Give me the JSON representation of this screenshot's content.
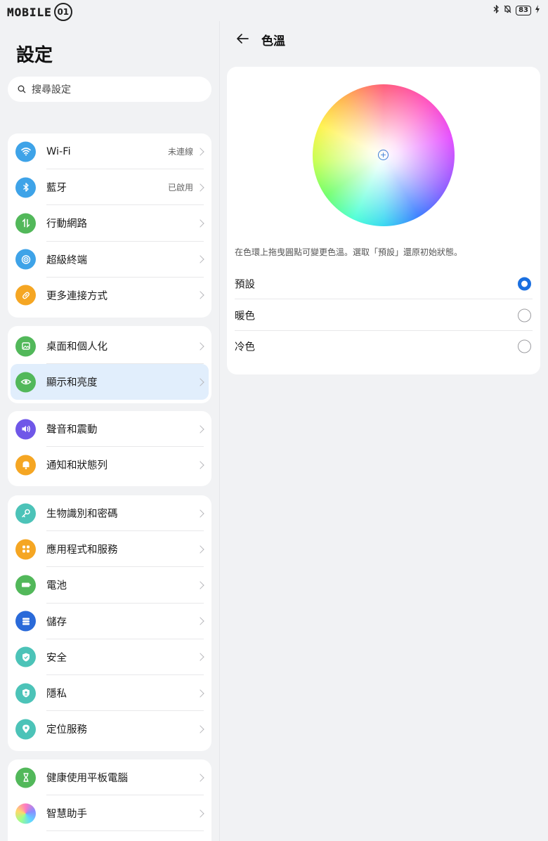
{
  "status_bar": {
    "logo": "MOBILE",
    "battery": "83"
  },
  "left_panel": {
    "title": "設定",
    "search_placeholder": "搜尋設定",
    "groups": [
      {
        "items": [
          {
            "label": "Wi-Fi",
            "value": "未連線",
            "icon": "wifi-icon",
            "color": "#3ea3e8"
          },
          {
            "label": "藍牙",
            "value": "已啟用",
            "icon": "bluetooth-icon",
            "color": "#3ea3e8"
          },
          {
            "label": "行動網路",
            "value": "",
            "icon": "mobile-data-icon",
            "color": "#52b85a"
          },
          {
            "label": "超級終端",
            "value": "",
            "icon": "super-device-icon",
            "color": "#3ea3e8"
          },
          {
            "label": "更多連接方式",
            "value": "",
            "icon": "link-icon",
            "color": "#f5a623"
          }
        ]
      },
      {
        "items": [
          {
            "label": "桌面和個人化",
            "value": "",
            "icon": "wallpaper-icon",
            "color": "#52b85a"
          },
          {
            "label": "顯示和亮度",
            "value": "",
            "icon": "eye-icon",
            "color": "#52b85a"
          }
        ]
      },
      {
        "items": [
          {
            "label": "聲音和震動",
            "value": "",
            "icon": "speaker-icon",
            "color": "#6f57e8"
          },
          {
            "label": "通知和狀態列",
            "value": "",
            "icon": "bell-icon",
            "color": "#f5a623"
          }
        ]
      },
      {
        "items": [
          {
            "label": "生物識別和密碼",
            "value": "",
            "icon": "key-icon",
            "color": "#4cc3b8"
          },
          {
            "label": "應用程式和服務",
            "value": "",
            "icon": "apps-icon",
            "color": "#f5a623"
          },
          {
            "label": "電池",
            "value": "",
            "icon": "battery-icon",
            "color": "#52b85a"
          },
          {
            "label": "儲存",
            "value": "",
            "icon": "storage-icon",
            "color": "#2a6ad9"
          },
          {
            "label": "安全",
            "value": "",
            "icon": "shield-icon",
            "color": "#4cc3b8"
          },
          {
            "label": "隱私",
            "value": "",
            "icon": "privacy-icon",
            "color": "#4cc3b8"
          },
          {
            "label": "定位服務",
            "value": "",
            "icon": "location-icon",
            "color": "#4cc3b8"
          }
        ]
      },
      {
        "items": [
          {
            "label": "健康使用平板電腦",
            "value": "",
            "icon": "hourglass-icon",
            "color": "#52b85a"
          },
          {
            "label": "智慧助手",
            "value": "",
            "icon": "assistant-icon",
            "color": "#c77be8"
          }
        ]
      }
    ]
  },
  "right_panel": {
    "title": "色溫",
    "hint": "在色環上拖曳圓點可變更色溫。選取「預設」還原初始狀態。",
    "options": [
      {
        "label": "預設",
        "selected": true
      },
      {
        "label": "暖色",
        "selected": false
      },
      {
        "label": "冷色",
        "selected": false
      }
    ]
  }
}
